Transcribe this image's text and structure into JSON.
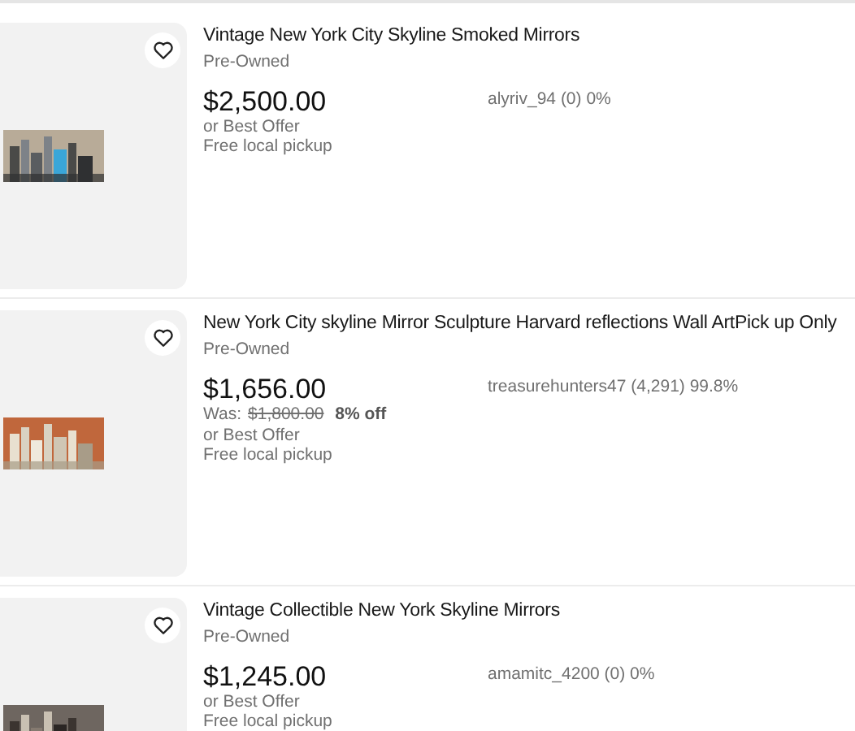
{
  "listings": [
    {
      "title": "Vintage New York City Skyline Smoked Mirrors",
      "condition": "Pre-Owned",
      "price": "$2,500.00",
      "best_offer": "or Best Offer",
      "shipping": "Free local pickup",
      "seller": "alyriv_94 (0) 0%"
    },
    {
      "title": "New York City skyline Mirror Sculpture Harvard reflections Wall ArtPick up Only",
      "condition": "Pre-Owned",
      "price": "$1,656.00",
      "was_label": "Was:",
      "was_price": "$1,800.00",
      "discount": "8% off",
      "best_offer": "or Best Offer",
      "shipping": "Free local pickup",
      "seller": "treasurehunters47 (4,291) 99.8%"
    },
    {
      "title": "Vintage Collectible New York Skyline Mirrors",
      "condition": "Pre-Owned",
      "price": "$1,245.00",
      "best_offer": "or Best Offer",
      "shipping": "Free local pickup",
      "seller": "amamitc_4200 (0) 0%"
    }
  ]
}
